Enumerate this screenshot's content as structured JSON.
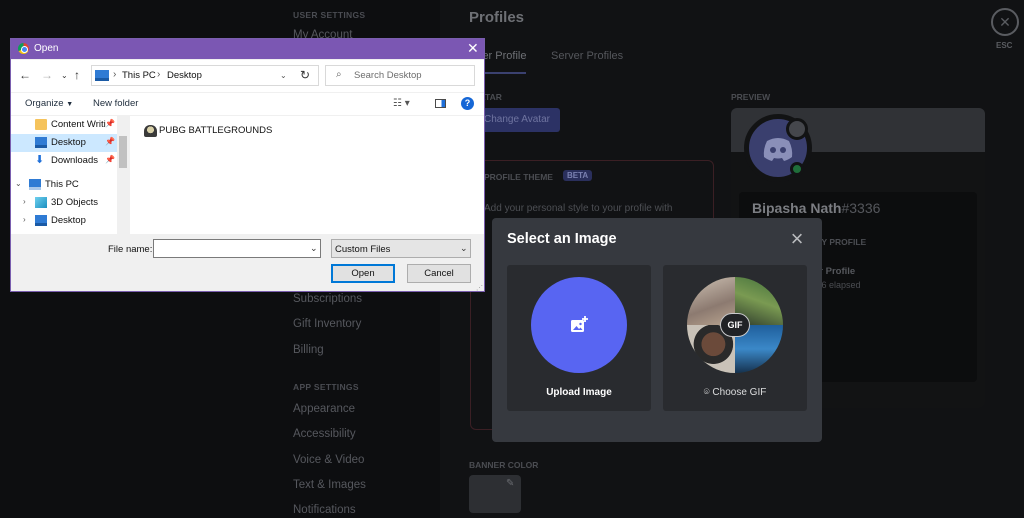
{
  "settings": {
    "sections": {
      "user_settings": "USER SETTINGS",
      "app_settings": "APP SETTINGS"
    },
    "nav_top": "My Account",
    "nav_items": [
      "Subscriptions",
      "Gift Inventory",
      "Billing"
    ],
    "app_items": [
      "Appearance",
      "Accessibility",
      "Voice & Video",
      "Text & Images",
      "Notifications"
    ],
    "page_title": "Profiles",
    "tabs": [
      "User Profile",
      "Server Profiles"
    ],
    "avatar_label": "AVATAR",
    "change_avatar": "Change Avatar",
    "theme_label": "PROFILE THEME",
    "beta": "BETA",
    "theme_desc": "Add your personal style to your profile with",
    "banner_color_label": "BANNER COLOR",
    "preview_label": "PREVIEW",
    "esc_label": "ESC",
    "preview": {
      "username": "Bipasha Nath",
      "discriminator": "#3336",
      "about_label": "ABOUT ME / MY PROFILE",
      "activity_name": "er Profile",
      "activity_time": ":36 elapsed"
    }
  },
  "modal": {
    "title": "Select an Image",
    "upload_label": "Upload Image",
    "gif_label": "Choose GIF",
    "gif_badge": "GIF",
    "upload_color": "#5865f2"
  },
  "dialog": {
    "title": "Open",
    "path": [
      "This PC",
      "Desktop"
    ],
    "search_placeholder": "Search Desktop",
    "organize": "Organize",
    "new_folder": "New folder",
    "tree": [
      {
        "label": "Content Writi",
        "pinned": true,
        "icon": "folder-icon"
      },
      {
        "label": "Desktop",
        "pinned": true,
        "icon": "desktop-icon",
        "selected": true
      },
      {
        "label": "Downloads",
        "pinned": true,
        "icon": "download-icon"
      },
      {
        "label": "This PC",
        "icon": "computer-icon"
      },
      {
        "label": "3D Objects",
        "icon": "cube-icon"
      },
      {
        "label": "Desktop",
        "icon": "desktop-icon"
      }
    ],
    "files": [
      "PUBG BATTLEGROUNDS"
    ],
    "file_name_label": "File name:",
    "file_name_value": "",
    "filter": "Custom Files",
    "open_btn": "Open",
    "cancel_btn": "Cancel",
    "accent": "#7b57b3"
  }
}
